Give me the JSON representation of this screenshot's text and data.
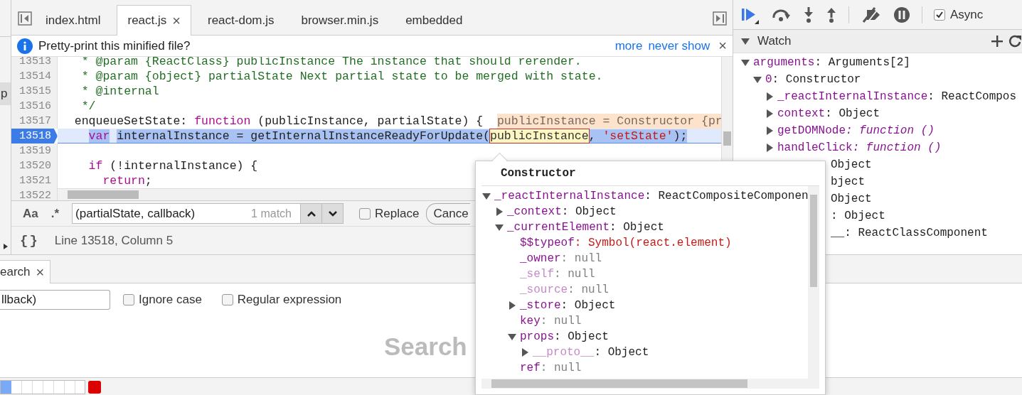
{
  "navigator": {
    "item": "p"
  },
  "editor": {
    "tabs": [
      {
        "label": "index.html",
        "selected": false
      },
      {
        "label": "react.js",
        "selected": true,
        "close": "×"
      },
      {
        "label": "react-dom.js",
        "selected": false
      },
      {
        "label": "browser.min.js",
        "selected": false
      },
      {
        "label": "embedded",
        "selected": false
      }
    ],
    "infobar": {
      "message": "Pretty-print this minified file?",
      "links": [
        "more",
        "never show"
      ],
      "close": "×"
    },
    "code": {
      "lines": [
        {
          "number": "13513",
          "current": false,
          "segments": [
            {
              "text": "   * @param {ReactClass} publicInstance The instance that should rerender.",
              "kind": "comment",
              "selected": false
            }
          ]
        },
        {
          "number": "13514",
          "current": false,
          "segments": [
            {
              "text": "   * @param {object} partialState Next partial state to be merged with state.",
              "kind": "comment",
              "selected": false
            }
          ]
        },
        {
          "number": "13515",
          "current": false,
          "segments": [
            {
              "text": "   * @internal",
              "kind": "comment",
              "selected": false
            }
          ]
        },
        {
          "number": "13516",
          "current": false,
          "segments": [
            {
              "text": "   */",
              "kind": "comment",
              "selected": false
            }
          ]
        },
        {
          "number": "13517",
          "current": false,
          "segments": [
            {
              "text": "  enqueueSetState: ",
              "kind": "plain",
              "selected": false
            },
            {
              "text": "function",
              "kind": "keyword",
              "selected": false
            },
            {
              "text": " (publicInstance, partialState) {  ",
              "kind": "plain",
              "selected": false
            },
            {
              "text": "publicInstance = Constructor {pr",
              "kind": "hint",
              "selected": false
            }
          ]
        },
        {
          "number": "13518",
          "current": true,
          "segments": [
            {
              "text": "    var",
              "kind": "keyword",
              "selected": true
            },
            {
              "text": " internalInstance = getInternalInstanceReadyForUpdate(",
              "kind": "plain",
              "selected": true
            },
            {
              "text": "publicInstance",
              "kind": "hover",
              "selected": false
            },
            {
              "text": ", ",
              "kind": "plain",
              "selected": true
            },
            {
              "text": "'setState'",
              "kind": "string",
              "selected": true
            },
            {
              "text": ");",
              "kind": "plain",
              "selected": true
            }
          ]
        },
        {
          "number": "13519",
          "current": false
        },
        {
          "number": "13520",
          "current": false,
          "segments": [
            {
              "text": "    if",
              "kind": "keyword",
              "selected": false
            },
            {
              "text": " (!internalInstance) {",
              "kind": "plain",
              "selected": false
            }
          ]
        },
        {
          "number": "13521",
          "current": false,
          "segments": [
            {
              "text": "      return",
              "kind": "keyword",
              "selected": false
            },
            {
              "text": ";",
              "kind": "plain",
              "selected": false
            }
          ]
        },
        {
          "number": "13522",
          "current": false
        }
      ]
    },
    "find": {
      "case_button": "Aa",
      "regex_button": ".*",
      "query": "(partialState, callback)",
      "matches": "1 match",
      "replace": {
        "label": "Replace",
        "checked": false
      },
      "cancel": "Cance"
    },
    "status": {
      "format_button": "{}",
      "position": "Line 13518, Column 5"
    }
  },
  "debugger": {
    "async": {
      "label": "Async",
      "checked": true
    },
    "watch": {
      "title": "Watch",
      "expanded": true,
      "tree": [
        {
          "name": "arguments",
          "value": ": Arguments[2]",
          "kind": "object",
          "expanded": true,
          "children": [
            {
              "name": "0",
              "value": ": Constructor",
              "kind": "object",
              "expanded": true,
              "children": [
                {
                  "name": "_reactInternalInstance",
                  "value": ": ReactCompos",
                  "kind": "object",
                  "expanded": false
                },
                {
                  "name": "context",
                  "value": ": Object",
                  "kind": "object",
                  "expanded": false
                },
                {
                  "name": "getDOMNode",
                  "value": ": function ()",
                  "kind": "function",
                  "expanded": false
                },
                {
                  "name": "handleClick",
                  "value": ": function ()",
                  "kind": "function",
                  "expanded": false
                }
              ]
            }
          ]
        }
      ],
      "tails": [
        "Object",
        "bject",
        "Object",
        ": Object",
        "__: ReactClassComponent"
      ]
    }
  },
  "drawer": {
    "tab": {
      "label": "earch",
      "close": "×",
      "selected": true
    },
    "query": "llback)",
    "options": [
      {
        "label": "Ignore case",
        "checked": false
      },
      {
        "label": "Regular expression",
        "checked": false
      }
    ],
    "empty_title": "Search",
    "progress": {
      "level": 0.13
    }
  },
  "popover": {
    "title": "Constructor",
    "tree": [
      {
        "name": "_reactInternalInstance",
        "value": ": ReactCompositeComponen",
        "kind": "object",
        "dimmed": false,
        "expanded": true,
        "children": [
          {
            "name": "_context",
            "value": ": Object",
            "kind": "object",
            "dimmed": false,
            "expanded": false
          },
          {
            "name": "_currentElement",
            "value": ": Object",
            "kind": "object",
            "dimmed": false,
            "expanded": true,
            "children": [
              {
                "name": "$$typeof",
                "value": ": Symbol(react.element)",
                "kind": "symbol",
                "dimmed": false
              },
              {
                "name": "_owner",
                "value": ": null",
                "kind": "null",
                "dimmed": false
              },
              {
                "name": "_self",
                "value": ": null",
                "kind": "null",
                "dimmed": true
              },
              {
                "name": "_source",
                "value": ": null",
                "kind": "null",
                "dimmed": true
              },
              {
                "name": "_store",
                "value": ": Object",
                "kind": "object",
                "dimmed": false,
                "expanded": false
              },
              {
                "name": "key",
                "value": ": null",
                "kind": "null",
                "dimmed": false
              },
              {
                "name": "props",
                "value": ": Object",
                "kind": "object",
                "dimmed": false,
                "expanded": true,
                "children": [
                  {
                    "name": "__proto__",
                    "value": ": Object",
                    "kind": "object",
                    "dimmed": true,
                    "expanded": false
                  }
                ]
              },
              {
                "name": "ref",
                "value": ": null",
                "kind": "null",
                "dimmed": false
              }
            ]
          }
        ]
      }
    ]
  }
}
